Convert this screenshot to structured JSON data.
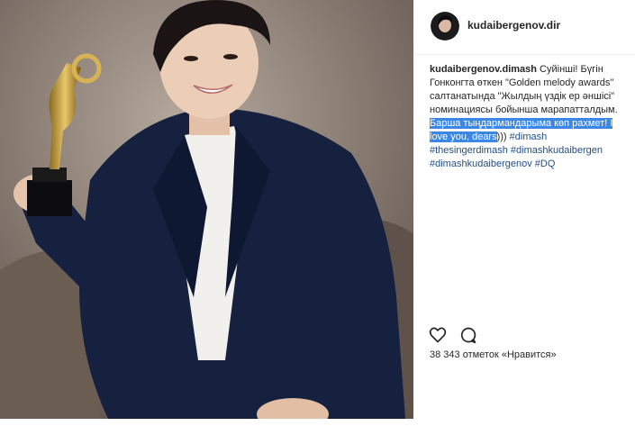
{
  "post": {
    "username": "kudaibergenov.dir",
    "caption": {
      "author": "kudaibergenov.dimash",
      "text": " Суйінші! Бүгін Гонконгта өткен \"Golden melody awards\" салтанатында \"Жылдың үздік ер әншісі\" номинациясы бойынша марапатталдым. ",
      "highlighted": "Барша тыңдармандарыма көп рахмет! I love you, dears",
      "after_highlight": "))) ",
      "hashtags": "#dimash #thesingerdimash #dimashkudaibergen #dimashkudaibergenov #DQ"
    },
    "likes_text": "38 343 отметок «Нравится»",
    "icons": {
      "like": "heart-icon",
      "comment": "comment-icon"
    }
  }
}
